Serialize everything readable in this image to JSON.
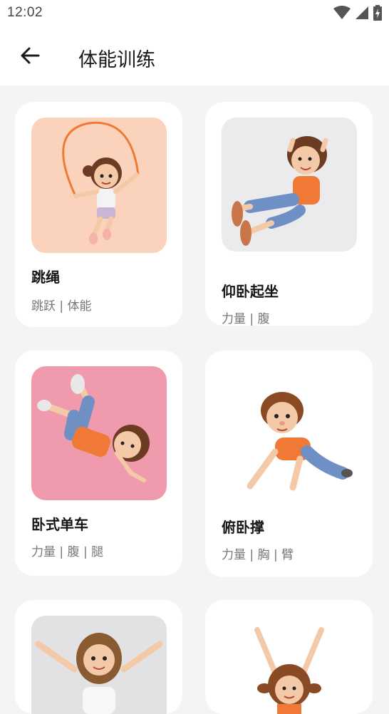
{
  "status_bar": {
    "time": "12:02"
  },
  "app_bar": {
    "title": "体能训练"
  },
  "exercises": [
    {
      "title": "跳绳",
      "tags": "跳跃 | 体能",
      "bg": "#fbd3bc"
    },
    {
      "title": "仰卧起坐",
      "tags": "力量 | 腹",
      "bg": "#ebebed"
    },
    {
      "title": "卧式单车",
      "tags": "力量 | 腹 | 腿",
      "bg": "#f09aae"
    },
    {
      "title": "俯卧撑",
      "tags": "力量 | 胸 | 臂",
      "bg": "#ffffff"
    },
    {
      "title": "",
      "tags": "",
      "bg": "#e2e2e4"
    },
    {
      "title": "",
      "tags": "",
      "bg": "#ffffff"
    }
  ],
  "colors": {
    "accent_orange": "#f07a35",
    "hair": "#6b3b22",
    "skin": "#f4c9a8",
    "denim": "#6f90c4"
  }
}
